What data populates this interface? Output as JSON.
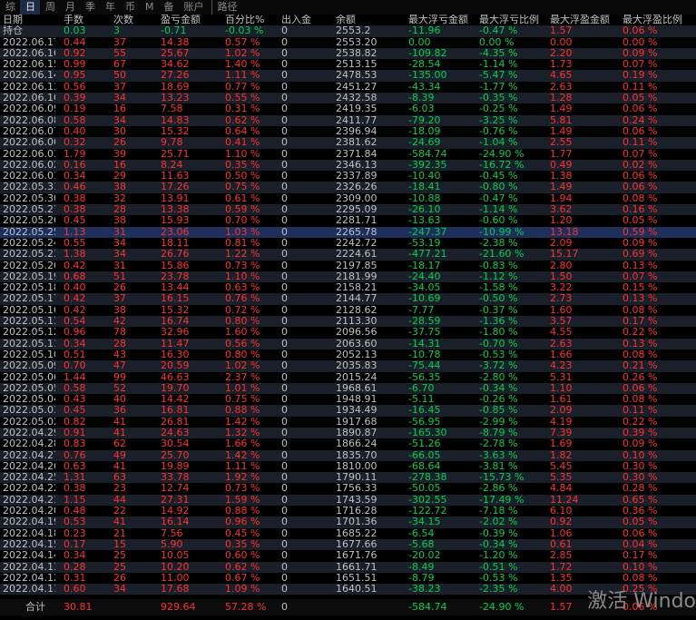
{
  "tabs": [
    "综",
    "日",
    "周",
    "月",
    "季",
    "年",
    "币",
    "M",
    "备",
    "账户",
    "路径"
  ],
  "active_tab_index": 1,
  "colors": {
    "up": "#ff3030",
    "down": "#00d050",
    "text": "#c0c0c0",
    "background": "#000000"
  },
  "headers": [
    "日期",
    "手数",
    "次数",
    "盈亏金额",
    "百分比%",
    "出入金",
    "余额",
    "最大浮亏金额",
    "最大浮亏比例",
    "最大浮盈金额",
    "最大浮盈比例"
  ],
  "holding": [
    "持仓",
    "0.03",
    "3",
    "-0.71",
    "-0.03 %",
    "0",
    "2553.2",
    "-11.96",
    "-0.47 %",
    "1.57",
    "0.06 %"
  ],
  "rows": [
    [
      "2022.06.17",
      "0.44",
      "37",
      "14.38",
      "0.57 %",
      "0",
      "2553.20",
      "0.00",
      "0.00 %",
      "0.00",
      "0.00 %"
    ],
    [
      "2022.06.16",
      "0.92",
      "55",
      "25.67",
      "1.02 %",
      "0",
      "2538.82",
      "-109.82",
      "-4.35 %",
      "2.20",
      "0.09 %"
    ],
    [
      "2022.06.15",
      "0.99",
      "67",
      "34.62",
      "1.40 %",
      "0",
      "2513.15",
      "-28.54",
      "-1.14 %",
      "1.73",
      "0.07 %"
    ],
    [
      "2022.06.14",
      "0.95",
      "50",
      "27.26",
      "1.11 %",
      "0",
      "2478.53",
      "-135.00",
      "-5.47 %",
      "4.65",
      "0.19 %"
    ],
    [
      "2022.06.13",
      "0.56",
      "37",
      "18.69",
      "0.77 %",
      "0",
      "2451.27",
      "-43.34",
      "-1.77 %",
      "2.63",
      "0.11 %"
    ],
    [
      "2022.06.10",
      "0.39",
      "34",
      "13.23",
      "0.55 %",
      "0",
      "2432.58",
      "-8.39",
      "-0.35 %",
      "1.28",
      "0.05 %"
    ],
    [
      "2022.06.09",
      "0.19",
      "16",
      "7.58",
      "0.31 %",
      "0",
      "2419.35",
      "-6.03",
      "-0.25 %",
      "1.49",
      "0.06 %"
    ],
    [
      "2022.06.08",
      "0.58",
      "34",
      "14.83",
      "0.62 %",
      "0",
      "2411.77",
      "-79.20",
      "-3.25 %",
      "5.81",
      "0.24 %"
    ],
    [
      "2022.06.07",
      "0.40",
      "30",
      "15.32",
      "0.64 %",
      "0",
      "2396.94",
      "-18.09",
      "-0.76 %",
      "1.49",
      "0.06 %"
    ],
    [
      "2022.06.06",
      "0.32",
      "26",
      "9.78",
      "0.41 %",
      "0",
      "2381.62",
      "-24.69",
      "-1.04 %",
      "2.55",
      "0.11 %"
    ],
    [
      "2022.06.03",
      "1.79",
      "39",
      "25.71",
      "1.10 %",
      "0",
      "2371.84",
      "-584.74",
      "-24.90 %",
      "1.77",
      "0.07 %"
    ],
    [
      "2022.06.02",
      "0.16",
      "16",
      "8.24",
      "0.35 %",
      "0",
      "2346.13",
      "-392.35",
      "-16.72 %",
      "0.49",
      "0.02 %"
    ],
    [
      "2022.06.01",
      "0.34",
      "29",
      "11.63",
      "0.50 %",
      "0",
      "2337.89",
      "-10.40",
      "-0.45 %",
      "1.38",
      "0.06 %"
    ],
    [
      "2022.05.31",
      "0.46",
      "38",
      "17.26",
      "0.75 %",
      "0",
      "2326.26",
      "-18.41",
      "-0.80 %",
      "1.49",
      "0.06 %"
    ],
    [
      "2022.05.30",
      "0.38",
      "32",
      "13.91",
      "0.61 %",
      "0",
      "2309.00",
      "-10.88",
      "-0.47 %",
      "1.94",
      "0.08 %"
    ],
    [
      "2022.05.27",
      "0.38",
      "28",
      "13.38",
      "0.59 %",
      "0",
      "2295.09",
      "-26.10",
      "-1.14 %",
      "3.62",
      "0.16 %"
    ],
    [
      "2022.05.26",
      "0.45",
      "38",
      "15.93",
      "0.70 %",
      "0",
      "2281.71",
      "-13.63",
      "-0.60 %",
      "1.20",
      "0.05 %"
    ],
    [
      "2022.05.25",
      "1.13",
      "31",
      "23.06",
      "1.03 %",
      "0",
      "2265.78",
      "-247.37",
      "-10.99 %",
      "13.18",
      "0.59 %"
    ],
    [
      "2022.05.24",
      "0.55",
      "34",
      "18.11",
      "0.81 %",
      "0",
      "2242.72",
      "-53.19",
      "-2.38 %",
      "2.09",
      "0.09 %"
    ],
    [
      "2022.05.23",
      "1.38",
      "34",
      "26.76",
      "1.22 %",
      "0",
      "2224.61",
      "-477.21",
      "-21.60 %",
      "15.17",
      "0.69 %"
    ],
    [
      "2022.05.20",
      "0.42",
      "31",
      "15.86",
      "0.73 %",
      "0",
      "2197.85",
      "-18.17",
      "-0.83 %",
      "2.80",
      "0.13 %"
    ],
    [
      "2022.05.19",
      "0.68",
      "51",
      "23.78",
      "1.10 %",
      "0",
      "2181.99",
      "-24.40",
      "-1.12 %",
      "1.50",
      "0.07 %"
    ],
    [
      "2022.05.18",
      "0.40",
      "26",
      "13.44",
      "0.63 %",
      "0",
      "2158.21",
      "-34.05",
      "-1.58 %",
      "3.22",
      "0.15 %"
    ],
    [
      "2022.05.17",
      "0.42",
      "37",
      "16.15",
      "0.76 %",
      "0",
      "2144.77",
      "-10.69",
      "-0.50 %",
      "2.73",
      "0.13 %"
    ],
    [
      "2022.05.16",
      "0.42",
      "38",
      "15.32",
      "0.72 %",
      "0",
      "2128.62",
      "-7.77",
      "-0.37 %",
      "1.60",
      "0.08 %"
    ],
    [
      "2022.05.13",
      "0.54",
      "42",
      "16.74",
      "0.80 %",
      "0",
      "2113.30",
      "-28.59",
      "-1.36 %",
      "3.57",
      "0.17 %"
    ],
    [
      "2022.05.12",
      "0.96",
      "78",
      "32.96",
      "1.60 %",
      "0",
      "2096.56",
      "-37.75",
      "-1.80 %",
      "4.55",
      "0.22 %"
    ],
    [
      "2022.05.11",
      "0.34",
      "28",
      "11.47",
      "0.56 %",
      "0",
      "2063.60",
      "-14.31",
      "-0.70 %",
      "2.63",
      "0.13 %"
    ],
    [
      "2022.05.10",
      "0.51",
      "43",
      "16.30",
      "0.80 %",
      "0",
      "2052.13",
      "-10.78",
      "-0.53 %",
      "1.66",
      "0.08 %"
    ],
    [
      "2022.05.09",
      "0.70",
      "47",
      "20.59",
      "1.02 %",
      "0",
      "2035.83",
      "-75.44",
      "-3.72 %",
      "4.23",
      "0.21 %"
    ],
    [
      "2022.05.06",
      "1.44",
      "99",
      "46.63",
      "2.37 %",
      "0",
      "2015.24",
      "-56.35",
      "-2.80 %",
      "5.31",
      "0.26 %"
    ],
    [
      "2022.05.05",
      "0.58",
      "52",
      "19.70",
      "1.01 %",
      "0",
      "1968.61",
      "-6.70",
      "-0.34 %",
      "1.10",
      "0.06 %"
    ],
    [
      "2022.05.04",
      "0.43",
      "40",
      "14.42",
      "0.75 %",
      "0",
      "1948.91",
      "-5.11",
      "-0.26 %",
      "1.61",
      "0.08 %"
    ],
    [
      "2022.05.03",
      "0.45",
      "36",
      "16.81",
      "0.88 %",
      "0",
      "1934.49",
      "-16.45",
      "-0.85 %",
      "2.09",
      "0.11 %"
    ],
    [
      "2022.05.02",
      "0.82",
      "41",
      "26.81",
      "1.42 %",
      "0",
      "1917.68",
      "-56.95",
      "-2.99 %",
      "4.19",
      "0.22 %"
    ],
    [
      "2022.04.29",
      "0.91",
      "41",
      "24.63",
      "1.32 %",
      "0",
      "1890.87",
      "-165.30",
      "-8.79 %",
      "7.39",
      "0.39 %"
    ],
    [
      "2022.04.28",
      "0.83",
      "62",
      "30.54",
      "1.66 %",
      "0",
      "1866.24",
      "-51.26",
      "-2.78 %",
      "1.69",
      "0.09 %"
    ],
    [
      "2022.04.27",
      "0.76",
      "49",
      "25.70",
      "1.42 %",
      "0",
      "1835.70",
      "-66.05",
      "-3.63 %",
      "1.82",
      "0.10 %"
    ],
    [
      "2022.04.26",
      "0.63",
      "41",
      "19.89",
      "1.11 %",
      "0",
      "1810.00",
      "-68.64",
      "-3.81 %",
      "5.45",
      "0.30 %"
    ],
    [
      "2022.04.25",
      "1.31",
      "63",
      "33.78",
      "1.92 %",
      "0",
      "1790.11",
      "-278.38",
      "-15.73 %",
      "5.35",
      "0.30 %"
    ],
    [
      "2022.04.22",
      "0.38",
      "23",
      "12.74",
      "0.73 %",
      "0",
      "1756.33",
      "-50.05",
      "-2.86 %",
      "4.84",
      "0.28 %"
    ],
    [
      "2022.04.21",
      "1.15",
      "44",
      "27.31",
      "1.59 %",
      "0",
      "1743.59",
      "-302.55",
      "-17.49 %",
      "11.24",
      "0.65 %"
    ],
    [
      "2022.04.20",
      "0.48",
      "22",
      "14.92",
      "0.88 %",
      "0",
      "1716.28",
      "-122.72",
      "-7.18 %",
      "6.10",
      "0.36 %"
    ],
    [
      "2022.04.19",
      "0.53",
      "41",
      "16.14",
      "0.96 %",
      "0",
      "1701.36",
      "-34.15",
      "-2.02 %",
      "0.92",
      "0.05 %"
    ],
    [
      "2022.04.18",
      "0.23",
      "21",
      "7.56",
      "0.45 %",
      "0",
      "1685.22",
      "-6.54",
      "-0.39 %",
      "1.06",
      "0.06 %"
    ],
    [
      "2022.04.15",
      "0.17",
      "15",
      "5.90",
      "0.35 %",
      "0",
      "1677.66",
      "-5.68",
      "-0.34 %",
      "0.61",
      "0.04 %"
    ],
    [
      "2022.04.14",
      "0.34",
      "25",
      "10.05",
      "0.60 %",
      "0",
      "1671.76",
      "-20.02",
      "-1.20 %",
      "2.85",
      "0.17 %"
    ],
    [
      "2022.04.13",
      "0.28",
      "25",
      "10.20",
      "0.62 %",
      "0",
      "1661.71",
      "-8.49",
      "-0.51 %",
      "1.72",
      "0.10 %"
    ],
    [
      "2022.04.12",
      "0.31",
      "26",
      "11.00",
      "0.67 %",
      "0",
      "1651.51",
      "-8.79",
      "-0.53 %",
      "1.35",
      "0.08 %"
    ],
    [
      "2022.04.11",
      "0.60",
      "34",
      "17.68",
      "1.09 %",
      "0",
      "1640.51",
      "-38.23",
      "-2.35 %",
      "4.00",
      "0.25 %"
    ]
  ],
  "totals": [
    "合计",
    "30.81",
    "",
    "929.64",
    "57.28 %",
    "0",
    "",
    "-584.74",
    "-24.90 %",
    "1.57",
    "0.06 %"
  ],
  "watermark": "激活 Windo"
}
